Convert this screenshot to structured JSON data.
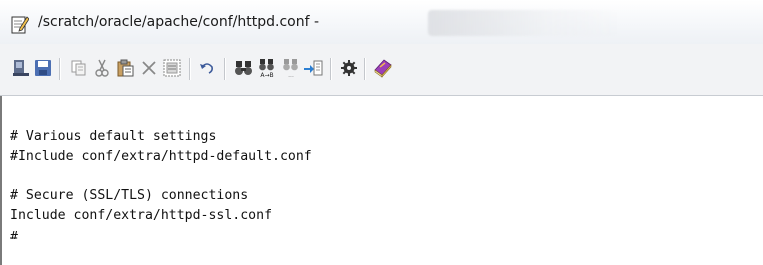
{
  "window": {
    "title": "/scratch/oracle/apache/conf/httpd.conf - "
  },
  "toolbar": {
    "buttons": [
      {
        "icon": "file-open-icon"
      },
      {
        "icon": "save-icon"
      },
      {
        "icon": "copy-icon"
      },
      {
        "icon": "cut-icon"
      },
      {
        "icon": "paste-icon"
      },
      {
        "icon": "delete-icon"
      },
      {
        "icon": "select-all-icon"
      },
      {
        "icon": "undo-icon"
      },
      {
        "icon": "find-icon"
      },
      {
        "icon": "replace-icon"
      },
      {
        "icon": "find-next-icon"
      },
      {
        "icon": "goto-line-icon"
      },
      {
        "icon": "settings-icon"
      },
      {
        "icon": "help-icon"
      }
    ]
  },
  "editor": {
    "lines": [
      "",
      "# Various default settings",
      "#Include conf/extra/httpd-default.conf",
      "",
      "# Secure (SSL/TLS) connections",
      "Include conf/extra/httpd-ssl.conf",
      "#"
    ]
  }
}
